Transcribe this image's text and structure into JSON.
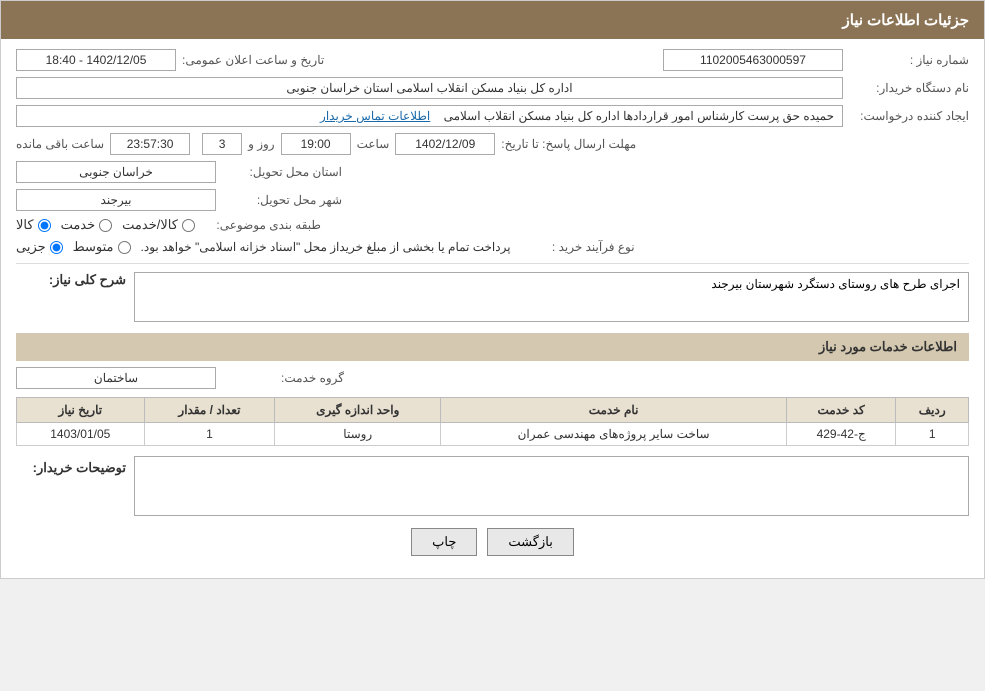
{
  "header": {
    "title": "جزئیات اطلاعات نیاز"
  },
  "fields": {
    "need_number_label": "شماره نیاز :",
    "need_number_value": "1102005463000597",
    "buyer_org_label": "نام دستگاه خریدار:",
    "buyer_org_value": "اداره کل بنیاد مسکن انقلاب اسلامی استان خراسان جنوبی",
    "creator_label": "ایجاد کننده درخواست:",
    "creator_value": "حمیده حق پرست کارشناس امور قراردادها اداره کل بنیاد مسکن انقلاب اسلامی",
    "contact_label": "اطلاعات تماس خریدار",
    "deadline_label": "مهلت ارسال پاسخ: تا تاریخ:",
    "announce_date_label": "تاریخ و ساعت اعلان عمومی:",
    "announce_date_value": "1402/12/05 - 18:40",
    "deadline_date_value": "1402/12/09",
    "deadline_time_value": "19:00",
    "deadline_days_value": "3",
    "deadline_remaining_value": "23:57:30",
    "deadline_days_label": "روز و",
    "deadline_time_label": "ساعت",
    "deadline_remaining_label": "ساعت باقی مانده",
    "province_label": "استان محل تحویل:",
    "province_value": "خراسان جنوبی",
    "city_label": "شهر محل تحویل:",
    "city_value": "بیرجند",
    "category_label": "طبقه بندی موضوعی:",
    "category_kala": "کالا",
    "category_khedmat": "خدمت",
    "category_kala_khedmat": "کالا/خدمت",
    "purchase_type_label": "نوع فرآیند خرید :",
    "purchase_jozvi": "جزیی",
    "purchase_motavvaset": "متوسط",
    "purchase_desc": "پرداخت تمام یا بخشی از مبلغ خریداز محل \"اسناد خزانه اسلامی\" خواهد بود.",
    "need_desc_label": "شرح کلی نیاز:",
    "need_desc_value": "اجرای طرح های روستای دستگرد شهرستان بیرجند",
    "services_info_title": "اطلاعات خدمات مورد نیاز",
    "service_group_label": "گروه خدمت:",
    "service_group_value": "ساختمان",
    "table_headers": {
      "row_number": "ردیف",
      "service_code": "کد خدمت",
      "service_name": "نام خدمت",
      "unit": "واحد اندازه گیری",
      "count": "تعداد / مقدار",
      "date": "تاریخ نیاز"
    },
    "table_rows": [
      {
        "row": "1",
        "code": "ج-42-429",
        "name": "ساخت سایر پروژه‌های مهندسی عمران",
        "unit": "روستا",
        "count": "1",
        "date": "1403/01/05"
      }
    ],
    "buyer_desc_label": "توضیحات خریدار:",
    "buyer_desc_value": "",
    "btn_back": "بازگشت",
    "btn_print": "چاپ"
  }
}
